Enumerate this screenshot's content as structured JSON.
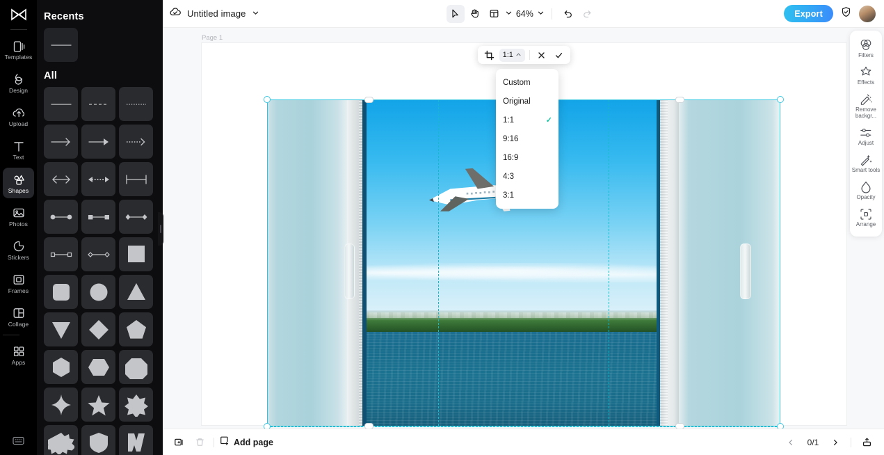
{
  "app": {
    "name": "CapCut"
  },
  "left_rail": {
    "logo": "capcut-logo",
    "items": [
      {
        "label": "Templates",
        "icon": "templates-icon",
        "active": false
      },
      {
        "label": "Design",
        "icon": "design-icon",
        "active": false
      },
      {
        "label": "Upload",
        "icon": "upload-icon",
        "active": false
      },
      {
        "label": "Text",
        "icon": "text-icon",
        "active": false
      },
      {
        "label": "Shapes",
        "icon": "shapes-icon",
        "active": true
      },
      {
        "label": "Photos",
        "icon": "photos-icon",
        "active": false
      },
      {
        "label": "Stickers",
        "icon": "stickers-icon",
        "active": false
      },
      {
        "label": "Frames",
        "icon": "frames-icon",
        "active": false
      },
      {
        "label": "Collage",
        "icon": "collage-icon",
        "active": false
      },
      {
        "label": "Apps",
        "icon": "apps-icon",
        "active": false
      }
    ],
    "bottom_icon": "keyboard-shortcuts-icon"
  },
  "shapes_panel": {
    "recents_title": "Recents",
    "all_title": "All",
    "recents": [
      {
        "shape": "line"
      }
    ],
    "shapes": [
      {
        "shape": "line"
      },
      {
        "shape": "dashed-line"
      },
      {
        "shape": "dotted-line"
      },
      {
        "shape": "arrow-thin"
      },
      {
        "shape": "arrow-solid"
      },
      {
        "shape": "dotted-arrow"
      },
      {
        "shape": "double-arrow"
      },
      {
        "shape": "dotted-double-arrow"
      },
      {
        "shape": "dimension-line"
      },
      {
        "shape": "circle-endpoints-line"
      },
      {
        "shape": "square-endpoints-line"
      },
      {
        "shape": "diamond-endpoints-line"
      },
      {
        "shape": "small-square-endpoints-line"
      },
      {
        "shape": "small-diamond-endpoints-line"
      },
      {
        "shape": "square"
      },
      {
        "shape": "rounded-square"
      },
      {
        "shape": "circle"
      },
      {
        "shape": "triangle-up"
      },
      {
        "shape": "triangle-down"
      },
      {
        "shape": "diamond"
      },
      {
        "shape": "pentagon"
      },
      {
        "shape": "hexagon-vertical"
      },
      {
        "shape": "hexagon-horizontal"
      },
      {
        "shape": "octagon"
      },
      {
        "shape": "four-point-star"
      },
      {
        "shape": "five-point-star"
      },
      {
        "shape": "six-point-star"
      },
      {
        "shape": "burst"
      },
      {
        "shape": "shield"
      },
      {
        "shape": "chevron"
      }
    ],
    "collapse_handle": "panel-collapse-handle"
  },
  "topbar": {
    "cloud_icon": "cloud-saved-icon",
    "doc_title": "Untitled image",
    "doc_caret": "chevron-down-icon",
    "tools": [
      {
        "name": "select-tool",
        "icon": "cursor-arrow-icon",
        "active": true
      },
      {
        "name": "hand-tool",
        "icon": "hand-icon",
        "active": false
      },
      {
        "name": "layout-tool",
        "icon": "layout-icon",
        "active": false
      }
    ],
    "layout_caret": "chevron-down-icon",
    "zoom_value": "64%",
    "zoom_caret": "chevron-down-icon",
    "undo_icon": "undo-icon",
    "redo_icon": "redo-icon",
    "export_label": "Export",
    "shield_icon": "shield-check-icon",
    "avatar": "user-avatar",
    "accent_color": "#33a6f5"
  },
  "canvas": {
    "page_label": "Page 1",
    "image_alt": "airplane-over-sea-through-window",
    "crop_guide_color": "#17b8c9",
    "crop_outline_color": "#2ec5e0"
  },
  "crop_toolbar": {
    "crop_icon": "crop-icon",
    "ratio_label": "1:1",
    "ratio_caret": "chevron-up-icon",
    "cancel_icon": "close-icon",
    "confirm_icon": "check-icon"
  },
  "ratio_menu": {
    "items": [
      {
        "label": "Custom",
        "selected": false
      },
      {
        "label": "Original",
        "selected": false
      },
      {
        "label": "1:1",
        "selected": true
      },
      {
        "label": "9:16",
        "selected": false
      },
      {
        "label": "16:9",
        "selected": false
      },
      {
        "label": "4:3",
        "selected": false
      },
      {
        "label": "3:1",
        "selected": false
      }
    ],
    "check_color": "#19c3a3"
  },
  "right_dock": {
    "items": [
      {
        "label": "Filters",
        "icon": "filters-icon"
      },
      {
        "label": "Effects",
        "icon": "effects-icon"
      },
      {
        "label": "Remove backgr...",
        "icon": "remove-background-icon"
      },
      {
        "label": "Adjust",
        "icon": "adjust-icon"
      },
      {
        "label": "Smart tools",
        "icon": "smart-tools-icon"
      },
      {
        "label": "Opacity",
        "icon": "opacity-icon"
      },
      {
        "label": "Arrange",
        "icon": "arrange-icon"
      }
    ]
  },
  "bottombar": {
    "duplicate_icon": "duplicate-page-icon",
    "delete_icon": "trash-icon",
    "add_page_icon": "add-page-icon",
    "add_page_label": "Add page",
    "prev_icon": "chevron-left-icon",
    "page_counter": "0/1",
    "next_icon": "chevron-right-icon",
    "export_image_icon": "export-image-icon"
  }
}
